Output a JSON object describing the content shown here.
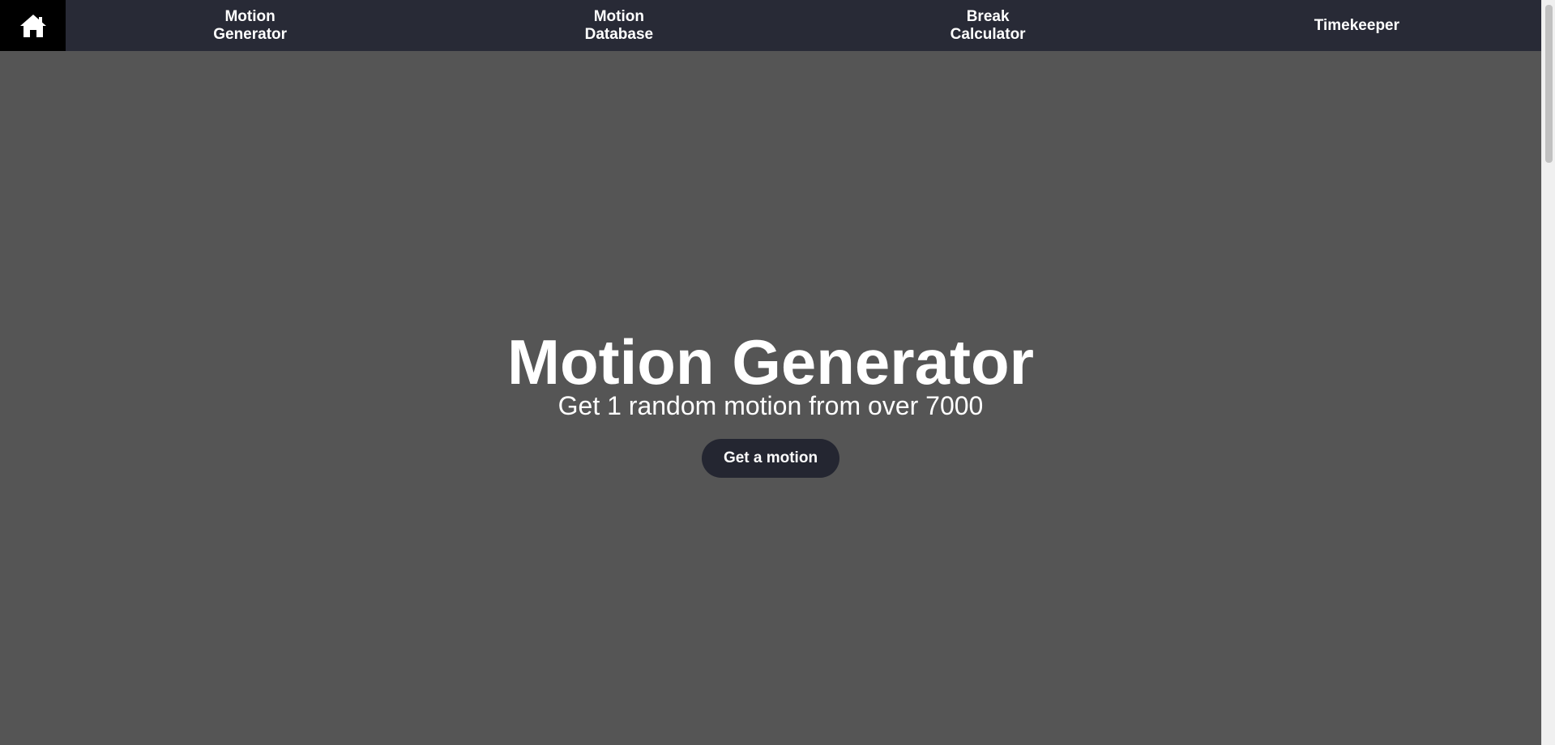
{
  "nav": {
    "home_icon": "home-icon",
    "items": [
      {
        "label": "Motion\nGenerator"
      },
      {
        "label": "Motion\nDatabase"
      },
      {
        "label": "Break\nCalculator"
      },
      {
        "label": "Timekeeper"
      }
    ]
  },
  "hero": {
    "title": "Motion Generator",
    "subtitle": "Get 1 random motion from over 7000",
    "button_label": "Get a motion"
  },
  "colors": {
    "page_background": "#555555",
    "navbar_background": "#282a36",
    "home_background": "#000000",
    "button_background": "#242631",
    "text": "#ffffff"
  }
}
